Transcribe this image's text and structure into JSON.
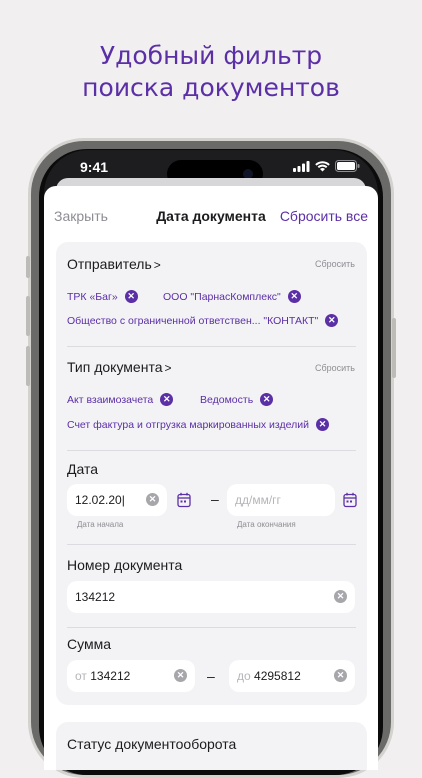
{
  "promo": {
    "line1": "Удобный фильтр",
    "line2": "поиска документов"
  },
  "status": {
    "time": "9:41"
  },
  "nav": {
    "close": "Закрыть",
    "title": "Дата документа",
    "reset_all": "Сбросить все"
  },
  "sender": {
    "title": "Отправитель",
    "reset": "Сбросить",
    "chips": [
      "ТРК «Баг»",
      "ООО \"ПарнасКомплекс\"",
      "Общество с ограниченной ответствен... \"КОНТАКТ\""
    ]
  },
  "doc_type": {
    "title": "Тип документа",
    "reset": "Сбросить",
    "chips": [
      "Акт взаимозачета",
      "Ведомость",
      "Счет фактура и отгрузка маркированных изделий"
    ]
  },
  "date": {
    "title": "Дата",
    "start_value": "12.02.20|",
    "end_placeholder": "дд/мм/гг",
    "start_caption": "Дата начала",
    "end_caption": "Дата окончания",
    "separator": "–"
  },
  "doc_number": {
    "title": "Номер документа",
    "value": "134212"
  },
  "sum": {
    "title": "Сумма",
    "from_prefix": "от",
    "from_value": "134212",
    "to_prefix": "до",
    "to_value": "4295812",
    "separator": "–"
  },
  "doc_status": {
    "title": "Статус документооборота"
  },
  "colors": {
    "accent": "#5b2fa6",
    "card_bg": "#f3f3f5",
    "page_bg": "#f1eff0"
  }
}
